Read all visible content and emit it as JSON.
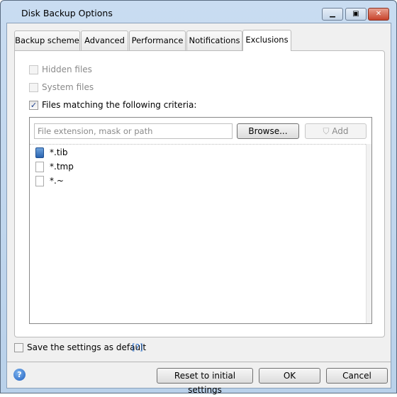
{
  "window": {
    "title": "Disk Backup Options",
    "minimize_icon": "minimize-icon",
    "maximize_icon": "maximize-icon",
    "close_icon": "close-icon"
  },
  "tabs": [
    {
      "label": "Backup scheme"
    },
    {
      "label": "Advanced"
    },
    {
      "label": "Performance"
    },
    {
      "label": "Notifications"
    },
    {
      "label": "Exclusions",
      "active": true
    }
  ],
  "exclusions": {
    "hidden_files": {
      "label": "Hidden files",
      "checked": false,
      "enabled": false
    },
    "system_files": {
      "label": "System files",
      "checked": false,
      "enabled": false
    },
    "criteria": {
      "label": "Files matching the following criteria:",
      "checked": true
    },
    "input_placeholder": "File extension, mask or path",
    "browse_label": "Browse...",
    "add_label": "Add",
    "items": [
      {
        "text": "*.tib",
        "icon": "tib-file-icon"
      },
      {
        "text": "*.tmp",
        "icon": "file-icon"
      },
      {
        "text": "*.~",
        "icon": "file-icon"
      }
    ]
  },
  "save_default": {
    "label": "Save the settings as default",
    "help": "[?]",
    "checked": false
  },
  "footer": {
    "reset_label": "Reset to initial settings",
    "ok_label": "OK",
    "cancel_label": "Cancel",
    "help_icon": "help-icon"
  },
  "colors": {
    "accent": "#2a6fcc",
    "link": "#2a6fcc"
  }
}
